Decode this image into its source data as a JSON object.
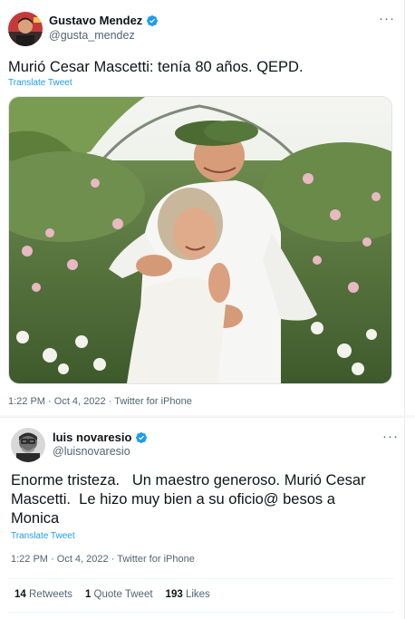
{
  "tweet1": {
    "display_name": "Gustavo Mendez",
    "handle": "@gusta_mendez",
    "text": "Murió Cesar Mascetti: tenía 80 años. QEPD.",
    "translate_label": "Translate Tweet",
    "time": "1:22 PM",
    "separator": "·",
    "date": "Oct 4, 2022",
    "source": "Twitter for iPhone",
    "more_icon": "more-icon"
  },
  "tweet2": {
    "display_name": "luis novaresio",
    "handle": "@luisnovaresio",
    "text_lines": [
      "Enorme tristeza.   Un maestro generoso. Murió Cesar",
      "Mascetti.  Le hizo muy bien a su oficio@ besos a",
      "Monica"
    ],
    "translate_label": "Translate Tweet",
    "time": "1:22 PM",
    "separator": "·",
    "date": "Oct 4, 2022",
    "source": "Twitter for iPhone",
    "stats": {
      "retweets_count": "14",
      "retweets_label": "Retweets",
      "quotes_count": "1",
      "quotes_label": "Quote Tweet",
      "likes_count": "193",
      "likes_label": "Likes"
    }
  },
  "colors": {
    "accent": "#1d9bf0",
    "verified": "#1d9bf0",
    "text": "#0f1419",
    "secondary": "#536471"
  }
}
